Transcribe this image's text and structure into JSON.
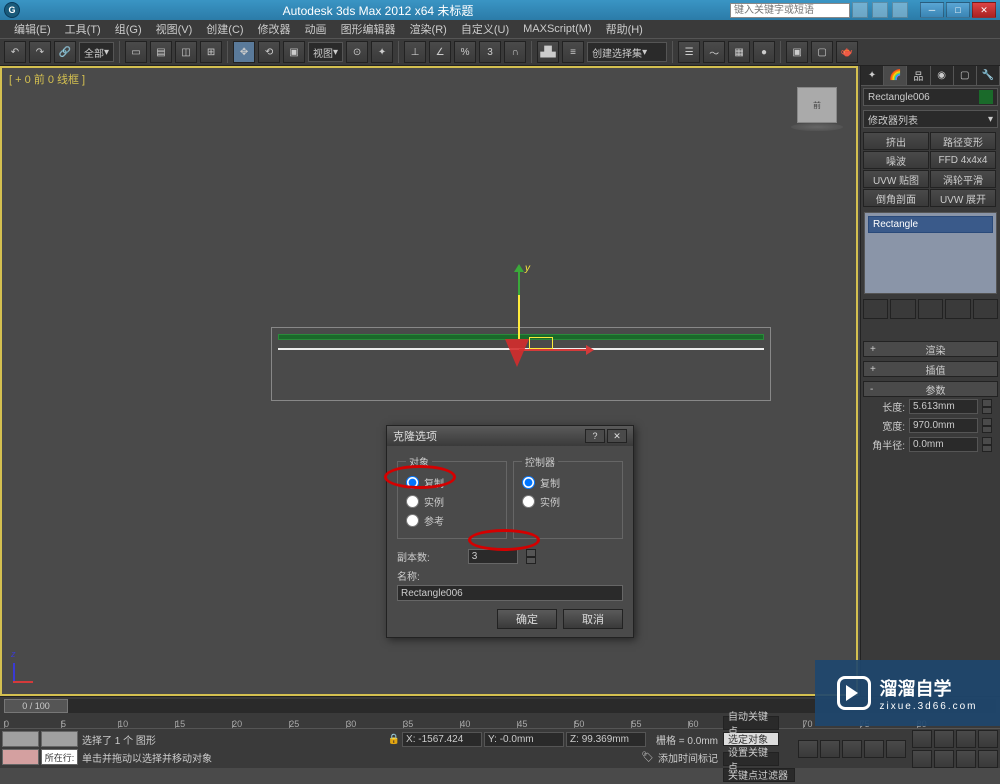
{
  "titlebar": {
    "title": "Autodesk 3ds Max 2012 x64   未标题",
    "search_placeholder": "键入关键字或短语"
  },
  "menu": [
    "编辑(E)",
    "工具(T)",
    "组(G)",
    "视图(V)",
    "创建(C)",
    "修改器",
    "动画",
    "图形编辑器",
    "渲染(R)",
    "自定义(U)",
    "MAXScript(M)",
    "帮助(H)"
  ],
  "toolbar": {
    "scope": "全部",
    "view": "视图",
    "selset": "创建选择集"
  },
  "viewport": {
    "label": "[ + 0 前 0 线框 ]",
    "axis_y": "y",
    "axis_z": "z"
  },
  "cmdpanel": {
    "objname": "Rectangle006",
    "modlist": "修改器列表",
    "mods": [
      "挤出",
      "路径变形",
      "噪波",
      "FFD 4x4x4",
      "UVW 贴图",
      "涡轮平滑",
      "倒角剖面",
      "UVW 展开"
    ],
    "stack_item": "Rectangle",
    "rollouts": {
      "render": "渲染",
      "interp": "插值",
      "params": "参数"
    },
    "params": {
      "length_label": "长度:",
      "length_val": "5.613mm",
      "width_label": "宽度:",
      "width_val": "970.0mm",
      "corner_label": "角半径:",
      "corner_val": "0.0mm"
    }
  },
  "dialog": {
    "title": "克隆选项",
    "group_obj": "对象",
    "group_ctrl": "控制器",
    "opt_copy": "复制",
    "opt_instance": "实例",
    "opt_reference": "参考",
    "copies_label": "副本数:",
    "copies_val": "3",
    "name_label": "名称:",
    "name_val": "Rectangle006",
    "ok": "确定",
    "cancel": "取消"
  },
  "timeline": {
    "range": "0 / 100",
    "ticks": [
      "0",
      "5",
      "10",
      "15",
      "20",
      "25",
      "30",
      "35",
      "40",
      "45",
      "50",
      "55",
      "60",
      "65",
      "70",
      "75",
      "80"
    ]
  },
  "status": {
    "current": "所在行:",
    "sel": "选择了 1 个 图形",
    "hint": "单击并拖动以选择并移动对象",
    "x": "X: -1567.424",
    "y": "Y: -0.0mm",
    "z": "Z: 99.369mm",
    "grid": "栅格 = 0.0mm",
    "addtime": "添加时间标记",
    "autokey": "自动关键点",
    "selset2": "选定对象",
    "setkey": "设置关键点",
    "keyfilter": "关键点过滤器"
  },
  "watermark": {
    "big": "溜溜自学",
    "small": "zixue.3d66.com"
  }
}
